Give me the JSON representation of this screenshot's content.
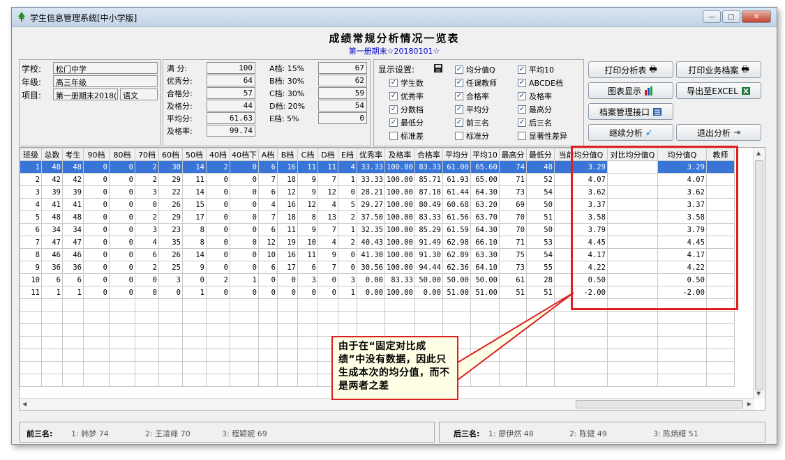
{
  "window": {
    "title": "学生信息管理系统[中小学版]"
  },
  "report": {
    "title": "成绩常规分析情况一览表",
    "subtitle": "第一册期末☆20180101☆"
  },
  "info": {
    "school_label": "学校:",
    "school": "松门中学",
    "grade_label": "年级:",
    "grade": "高三年级",
    "project_label": "项目:",
    "project": "第一册期末2018(",
    "subject": "语文"
  },
  "stats": {
    "full_label": "满  分:",
    "full": "100",
    "excellent_label": "优秀分:",
    "excellent": "64",
    "pass_label": "合格分:",
    "pass": "57",
    "qualify_label": "及格分:",
    "qualify": "44",
    "avg_label": "平均分:",
    "avg": "61.63",
    "qualify_rate_label": "及格率:",
    "qualify_rate": "99.74",
    "a_label": "A档: 15%",
    "a": "67",
    "b_label": "B档: 30%",
    "b": "62",
    "c_label": "C档: 30%",
    "c": "59",
    "d_label": "D档: 20%",
    "d": "54",
    "e_label": "E档: 5%",
    "e": "0"
  },
  "display": {
    "title": "显示设置:",
    "options": [
      {
        "label": "均分值Q",
        "checked": "✓"
      },
      {
        "label": "平均10",
        "checked": "✓"
      },
      {
        "label": "学生数",
        "checked": "✓"
      },
      {
        "label": "任课教师",
        "checked": "✓"
      },
      {
        "label": "ABCDE档",
        "checked": "✓"
      },
      {
        "label": "优秀率",
        "checked": "✓"
      },
      {
        "label": "合格率",
        "checked": "✓"
      },
      {
        "label": "及格率",
        "checked": "✓"
      },
      {
        "label": "分数档",
        "checked": "✓"
      },
      {
        "label": "平均分",
        "checked": "✓"
      },
      {
        "label": "最高分",
        "checked": "✓"
      },
      {
        "label": "最低分",
        "checked": "✓"
      },
      {
        "label": "前三名",
        "checked": "✓"
      },
      {
        "label": "后三名",
        "checked": "✓"
      },
      {
        "label": "标准差",
        "checked": ""
      },
      {
        "label": "标准分",
        "checked": ""
      },
      {
        "label": "显著性差异",
        "checked": ""
      }
    ]
  },
  "buttons": {
    "print_analysis": "打印分析表",
    "print_archive": "打印业务档案",
    "chart": "图表显示",
    "export": "导出至EXCEL",
    "archive_api": "档案管理接口",
    "continue": "继续分析",
    "exit": "退出分析"
  },
  "grid": {
    "columns": [
      "班级",
      "总数",
      "考生",
      "90档",
      "80档",
      "70档",
      "60档",
      "50档",
      "40档",
      "40档下",
      "A档",
      "B档",
      "C档",
      "D档",
      "E档",
      "优秀率",
      "及格率",
      "合格率",
      "平均分",
      "平均10",
      "最高分",
      "最低分",
      "当前均分值Q",
      "对比均分值Q",
      "均分值Q",
      "教师"
    ],
    "rows": [
      [
        "1",
        "48",
        "48",
        "0",
        "0",
        "2",
        "30",
        "14",
        "2",
        "0",
        "6",
        "16",
        "11",
        "11",
        "4",
        "33.33",
        "100.00",
        "83.33",
        "61.00",
        "65.60",
        "74",
        "48",
        "3.29",
        "",
        "3.29",
        ""
      ],
      [
        "2",
        "42",
        "42",
        "0",
        "0",
        "2",
        "29",
        "11",
        "0",
        "0",
        "7",
        "18",
        "9",
        "7",
        "1",
        "33.33",
        "100.00",
        "85.71",
        "61.93",
        "65.00",
        "71",
        "52",
        "4.07",
        "",
        "4.07",
        ""
      ],
      [
        "3",
        "39",
        "39",
        "0",
        "0",
        "3",
        "22",
        "14",
        "0",
        "0",
        "6",
        "12",
        "9",
        "12",
        "0",
        "28.21",
        "100.00",
        "87.18",
        "61.44",
        "64.30",
        "73",
        "54",
        "3.62",
        "",
        "3.62",
        ""
      ],
      [
        "4",
        "41",
        "41",
        "0",
        "0",
        "0",
        "26",
        "15",
        "0",
        "0",
        "4",
        "16",
        "12",
        "4",
        "5",
        "29.27",
        "100.00",
        "80.49",
        "60.68",
        "63.20",
        "69",
        "50",
        "3.37",
        "",
        "3.37",
        ""
      ],
      [
        "5",
        "48",
        "48",
        "0",
        "0",
        "2",
        "29",
        "17",
        "0",
        "0",
        "7",
        "18",
        "8",
        "13",
        "2",
        "37.50",
        "100.00",
        "83.33",
        "61.56",
        "63.70",
        "70",
        "51",
        "3.58",
        "",
        "3.58",
        ""
      ],
      [
        "6",
        "34",
        "34",
        "0",
        "0",
        "3",
        "23",
        "8",
        "0",
        "0",
        "6",
        "11",
        "9",
        "7",
        "1",
        "32.35",
        "100.00",
        "85.29",
        "61.59",
        "64.30",
        "70",
        "50",
        "3.79",
        "",
        "3.79",
        ""
      ],
      [
        "7",
        "47",
        "47",
        "0",
        "0",
        "4",
        "35",
        "8",
        "0",
        "0",
        "12",
        "19",
        "10",
        "4",
        "2",
        "40.43",
        "100.00",
        "91.49",
        "62.98",
        "66.10",
        "71",
        "53",
        "4.45",
        "",
        "4.45",
        ""
      ],
      [
        "8",
        "46",
        "46",
        "0",
        "0",
        "6",
        "26",
        "14",
        "0",
        "0",
        "10",
        "16",
        "11",
        "9",
        "0",
        "41.30",
        "100.00",
        "91.30",
        "62.89",
        "63.30",
        "75",
        "54",
        "4.17",
        "",
        "4.17",
        ""
      ],
      [
        "9",
        "36",
        "36",
        "0",
        "0",
        "2",
        "25",
        "9",
        "0",
        "0",
        "6",
        "17",
        "6",
        "7",
        "0",
        "30.56",
        "100.00",
        "94.44",
        "62.36",
        "64.10",
        "73",
        "55",
        "4.22",
        "",
        "4.22",
        ""
      ],
      [
        "10",
        "6",
        "6",
        "0",
        "0",
        "0",
        "3",
        "0",
        "2",
        "1",
        "0",
        "0",
        "3",
        "0",
        "3",
        "0.00",
        "83.33",
        "50.00",
        "50.00",
        "50.00",
        "61",
        "28",
        "0.50",
        "",
        "0.50",
        ""
      ],
      [
        "11",
        "1",
        "1",
        "0",
        "0",
        "0",
        "0",
        "1",
        "0",
        "0",
        "0",
        "0",
        "0",
        "0",
        "1",
        "0.00",
        "100.00",
        "0.00",
        "51.00",
        "51.00",
        "51",
        "51",
        "-2.00",
        "",
        "-2.00",
        ""
      ]
    ]
  },
  "callout": {
    "text": "由于在“固定对比成绩”中没有数据，因此只生成本次的均分值，而不是两者之差"
  },
  "status": {
    "top3_label": "前三名:",
    "top3": [
      "1: 韩梦  74",
      "2: 王凌峰 70",
      "3: 程颖妮 69"
    ],
    "bottom3_label": "后三名:",
    "bottom3": [
      "1: 廖伊然 48",
      "2: 陈健  49",
      "3: 陈炳缙 51"
    ]
  }
}
